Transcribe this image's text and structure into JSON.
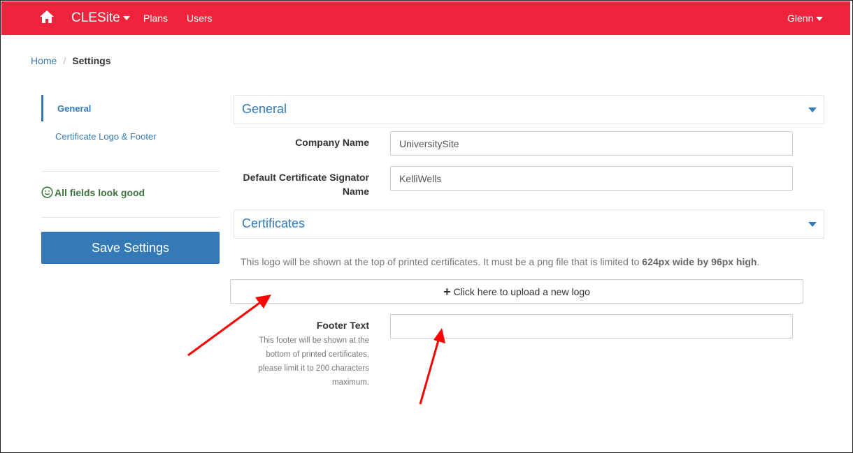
{
  "navbar": {
    "home_icon": "home-icon",
    "brand": "CLESite",
    "links": [
      "Plans",
      "Users"
    ],
    "user": "Glenn",
    "color": "#ef233c"
  },
  "breadcrumb": {
    "home": "Home",
    "separator": "/",
    "current": "Settings"
  },
  "sidebar": {
    "items": [
      {
        "label": "General",
        "active": true
      },
      {
        "label": "Certificate Logo & Footer",
        "active": false
      }
    ],
    "status_text": "All fields look good",
    "status_icon": "smile-icon",
    "save_label": "Save Settings"
  },
  "sections": {
    "general": {
      "title": "General",
      "company_name_label": "Company Name",
      "company_name_value": "UniversitySite",
      "signator_label_line1": "Default Certificate Signator",
      "signator_label_line2": "Name",
      "signator_value": "KelliWells"
    },
    "certificates": {
      "title": "Certificates",
      "logo_help_prefix": "This logo will be shown at the top of printed certificates. It must be a png file that is limited to ",
      "logo_help_bold": "624px wide by 96px high",
      "logo_help_suffix": ".",
      "upload_label": "Click here to upload a new logo",
      "footer_label": "Footer Text",
      "footer_value": "",
      "footer_help_lines": [
        "This footer will be shown at the",
        "bottom of printed certificates,",
        "please limit it to 200 characters",
        "maximum."
      ]
    }
  },
  "colors": {
    "accent": "#337ab7",
    "success": "#3c763d",
    "annotation": "#ff0000"
  }
}
